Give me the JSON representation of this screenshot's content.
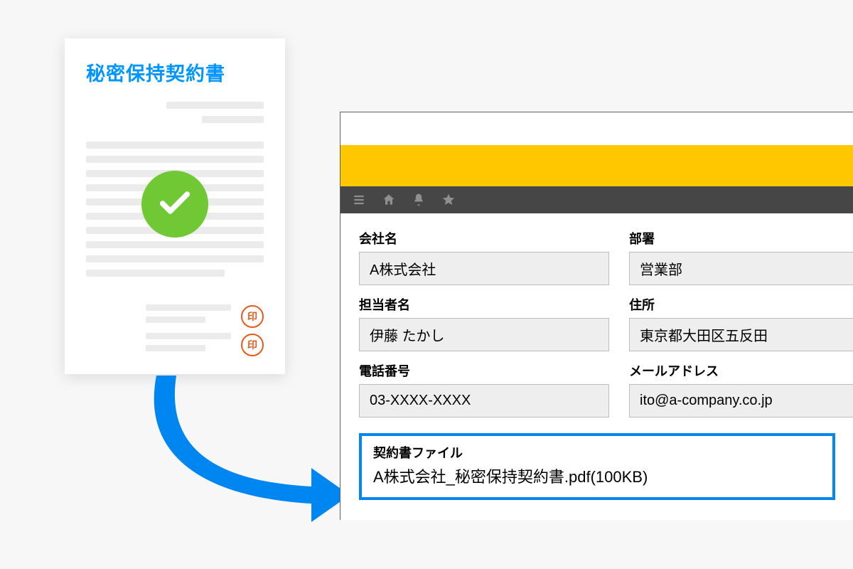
{
  "document": {
    "title": "秘密保持契約書",
    "stamp_glyph": "印"
  },
  "app": {
    "fields": {
      "company": {
        "label": "会社名",
        "value": "A株式会社"
      },
      "department": {
        "label": "部署",
        "value": "営業部"
      },
      "person": {
        "label": "担当者名",
        "value": "伊藤 たかし"
      },
      "address": {
        "label": "住所",
        "value": "東京都大田区五反田"
      },
      "phone": {
        "label": "電話番号",
        "value": "03-XXXX-XXXX"
      },
      "email": {
        "label": "メールアドレス",
        "value": "ito@a-company.co.jp"
      }
    },
    "file_field": {
      "label": "契約書ファイル",
      "value": "A株式会社_秘密保持契約書.pdf(100KB)"
    }
  },
  "colors": {
    "accent_blue": "#0086f0",
    "doc_title_blue": "#0096ff",
    "toolbar_bg": "#464646",
    "yellow_bar": "#ffc700",
    "check_green": "#6fc834",
    "stamp_orange": "#e85a19"
  }
}
